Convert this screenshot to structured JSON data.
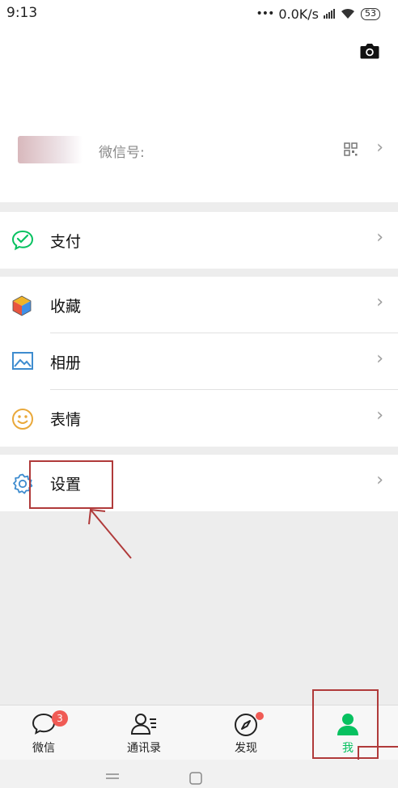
{
  "status_bar": {
    "time": "9:13",
    "network_speed": "0.0K/s",
    "battery": "53"
  },
  "profile": {
    "wechat_id_label": "微信号:"
  },
  "menu": {
    "pay": "支付",
    "favorites": "收藏",
    "album": "相册",
    "stickers": "表情",
    "settings": "设置"
  },
  "tabs": [
    {
      "label": "微信",
      "badge": "3"
    },
    {
      "label": "通讯录"
    },
    {
      "label": "发现"
    },
    {
      "label": "我"
    }
  ],
  "colors": {
    "accent_green": "#07c160",
    "badge_red": "#f05b55",
    "annotation_red": "#b03a3a"
  },
  "icons": [
    "camera-icon",
    "qr-code-icon",
    "pay-icon",
    "favorites-icon",
    "album-icon",
    "stickers-icon",
    "settings-icon",
    "chat-icon",
    "contacts-icon",
    "discover-icon",
    "me-icon"
  ]
}
